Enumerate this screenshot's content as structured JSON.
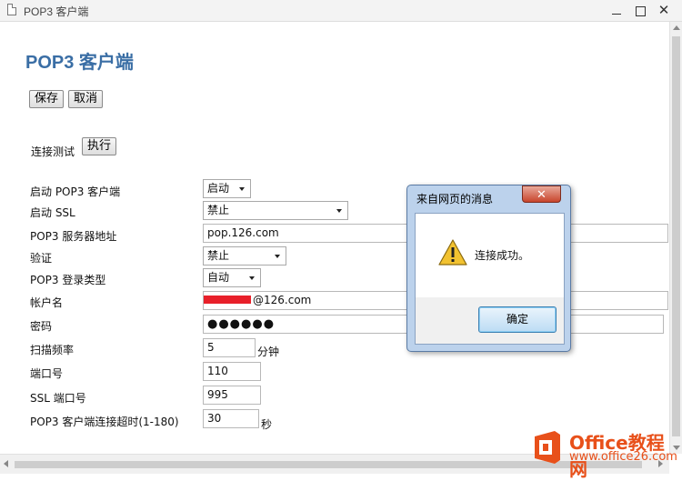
{
  "window": {
    "title": "POP3 客户端",
    "minimize_label": "",
    "maximize_label": "",
    "close_label": "✕"
  },
  "page": {
    "title": "POP3 客户端",
    "save_label": "保存",
    "cancel_label": "取消",
    "test_label": "连接测试",
    "execute_label": "执行"
  },
  "form": {
    "enable_pop3": {
      "label": "启动 POP3 客户端",
      "value": "启动"
    },
    "enable_ssl": {
      "label": "启动 SSL",
      "value": "禁止"
    },
    "server": {
      "label": "POP3 服务器地址",
      "value": "pop.126.com"
    },
    "auth": {
      "label": "验证",
      "value": "禁止"
    },
    "login_type": {
      "label": "POP3 登录类型",
      "value": "自动"
    },
    "account": {
      "label": "帐户名",
      "value": "@126.com"
    },
    "password": {
      "label": "密码",
      "value": "●●●●●●"
    },
    "scan_freq": {
      "label": "扫描频率",
      "value": "5",
      "unit": "分钟"
    },
    "port": {
      "label": "端口号",
      "value": "110"
    },
    "ssl_port": {
      "label": "SSL 端口号",
      "value": "995"
    },
    "timeout": {
      "label": "POP3 客户端连接超时(1-180)",
      "value": "30",
      "unit": "秒"
    }
  },
  "dialog": {
    "title": "来自网页的消息",
    "close_label": "✕",
    "message": "连接成功。",
    "ok_label": "确定",
    "icon": "warning-icon"
  },
  "watermark": {
    "brand": "Office教程网",
    "url": "www.office26.com"
  },
  "colors": {
    "title_blue": "#3a6ea5",
    "dialog_frame": "#bcd2ec",
    "warning_yellow": "#f2c230",
    "watermark_orange": "#e8501a"
  }
}
